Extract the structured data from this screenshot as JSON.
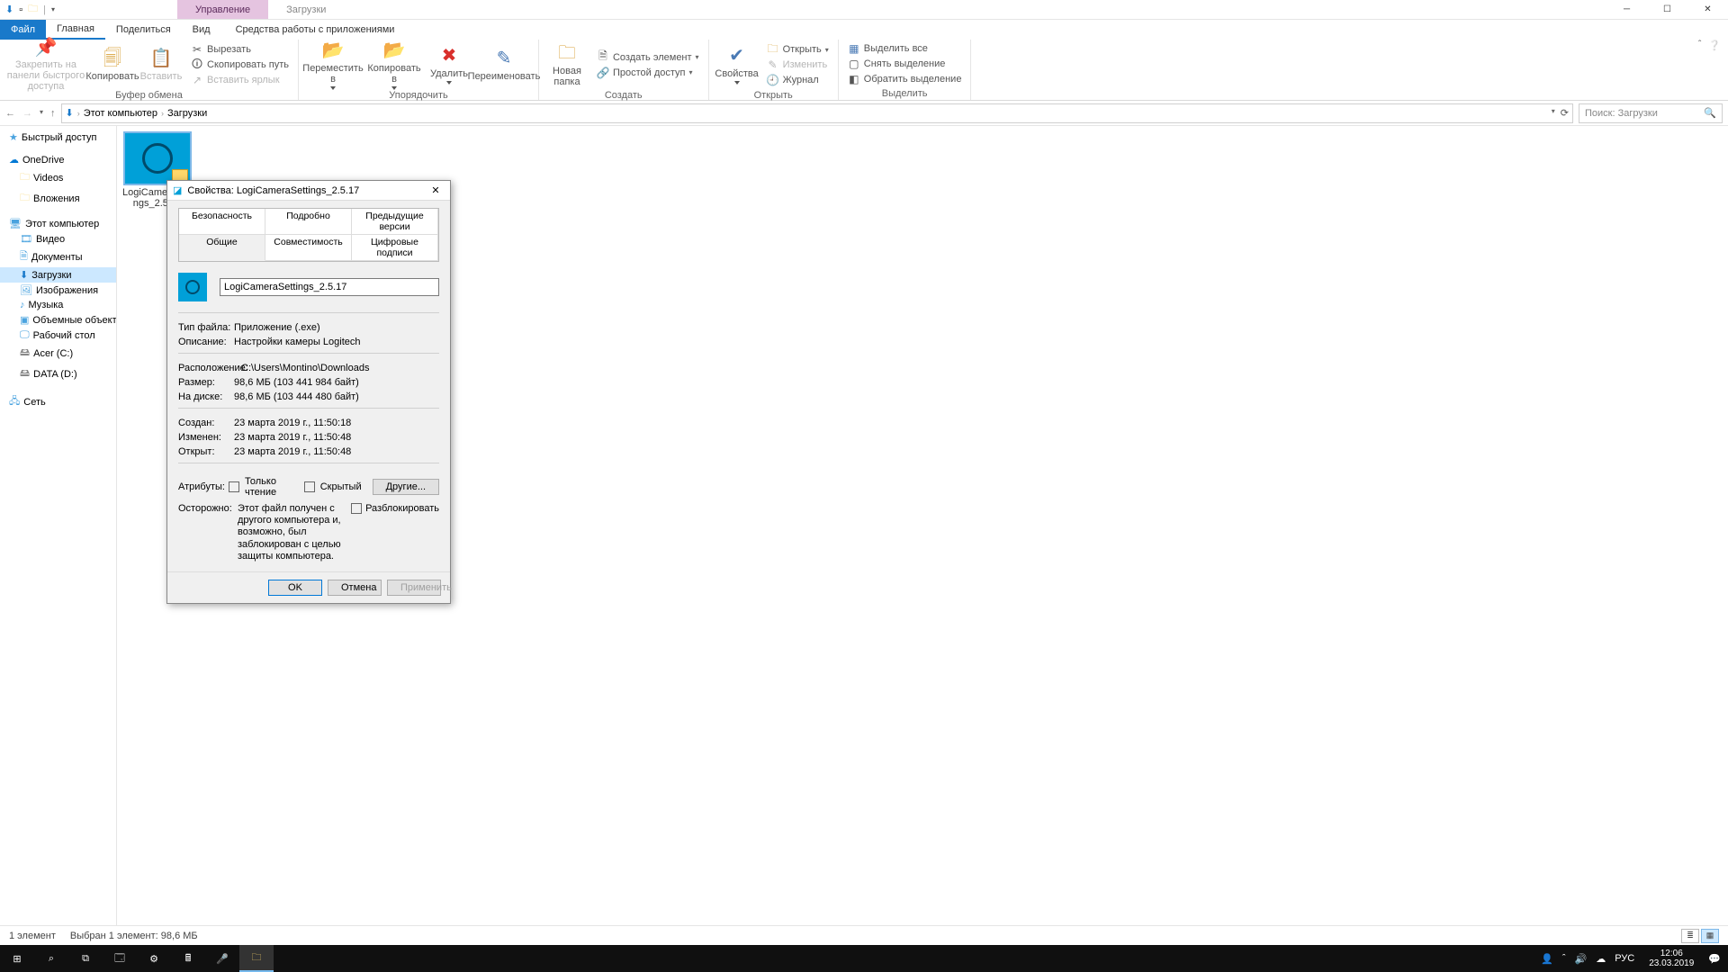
{
  "titlebar": {
    "manage_tab": "Управление",
    "location_tab": "Загрузки"
  },
  "tabs": {
    "file": "Файл",
    "home": "Главная",
    "share": "Поделиться",
    "view": "Вид",
    "apptools": "Средства работы с приложениями"
  },
  "ribbon": {
    "pin": "Закрепить на панели быстрого доступа",
    "copy": "Копировать",
    "paste": "Вставить",
    "cut": "Вырезать",
    "copy_path": "Скопировать путь",
    "paste_shortcut": "Вставить ярлык",
    "clipboard_group": "Буфер обмена",
    "move_to": "Переместить в",
    "copy_to": "Копировать в",
    "delete": "Удалить",
    "rename": "Переименовать",
    "organize_group": "Упорядочить",
    "new_folder": "Новая папка",
    "new_item": "Создать элемент",
    "easy_access": "Простой доступ",
    "create_group": "Создать",
    "properties": "Свойства",
    "open": "Открыть",
    "edit": "Изменить",
    "history": "Журнал",
    "open_group": "Открыть",
    "select_all": "Выделить все",
    "select_none": "Снять выделение",
    "invert_selection": "Обратить выделение",
    "select_group": "Выделить"
  },
  "addr": {
    "this_pc": "Этот компьютер",
    "downloads": "Загрузки"
  },
  "search": {
    "placeholder": "Поиск: Загрузки"
  },
  "tree": {
    "quick_access": "Быстрый доступ",
    "onedrive": "OneDrive",
    "od_videos": "Videos",
    "od_attachments": "Вложения",
    "this_pc": "Этот компьютер",
    "video": "Видео",
    "documents": "Документы",
    "downloads": "Загрузки",
    "pictures": "Изображения",
    "music": "Музыка",
    "objects3d": "Объемные объекты",
    "desktop": "Рабочий стол",
    "acer_c": "Acer (C:)",
    "data_d": "DATA (D:)",
    "network": "Сеть"
  },
  "file": {
    "name": "LogiCameraSettings_2.5.17",
    "name_wrapped_1": "LogiCameraSetti",
    "name_wrapped_2": "ngs_2.5.17"
  },
  "status": {
    "count": "1 элемент",
    "selected": "Выбран 1 элемент: 98,6 МБ"
  },
  "props": {
    "title": "Свойства: LogiCameraSettings_2.5.17",
    "tabs": {
      "security": "Безопасность",
      "details": "Подробно",
      "previous": "Предыдущие версии",
      "general": "Общие",
      "compat": "Совместимость",
      "signatures": "Цифровые подписи"
    },
    "filename": "LogiCameraSettings_2.5.17",
    "labels": {
      "type": "Тип файла:",
      "description": "Описание:",
      "location": "Расположение:",
      "size": "Размер:",
      "size_on_disk": "На диске:",
      "created": "Создан:",
      "modified": "Изменен:",
      "accessed": "Открыт:",
      "attributes": "Атрибуты:",
      "readonly": "Только чтение",
      "hidden": "Скрытый",
      "other": "Другие...",
      "warn_label": "Осторожно:",
      "warn_text": "Этот файл получен с другого компьютера и, возможно, был заблокирован с целью защиты компьютера.",
      "unblock": "Разблокировать"
    },
    "values": {
      "type": "Приложение (.exe)",
      "description": "Настройки камеры Logitech",
      "location": "C:\\Users\\Montino\\Downloads",
      "size": "98,6 МБ (103 441 984 байт)",
      "size_on_disk": "98,6 МБ (103 444 480 байт)",
      "created": "23 марта 2019 г., 11:50:18",
      "modified": "23 марта 2019 г., 11:50:48",
      "accessed": "23 марта 2019 г., 11:50:48"
    },
    "buttons": {
      "ok": "OK",
      "cancel": "Отмена",
      "apply": "Применить"
    }
  },
  "taskbar": {
    "lang": "РУС",
    "time": "12:06",
    "date": "23.03.2019"
  }
}
